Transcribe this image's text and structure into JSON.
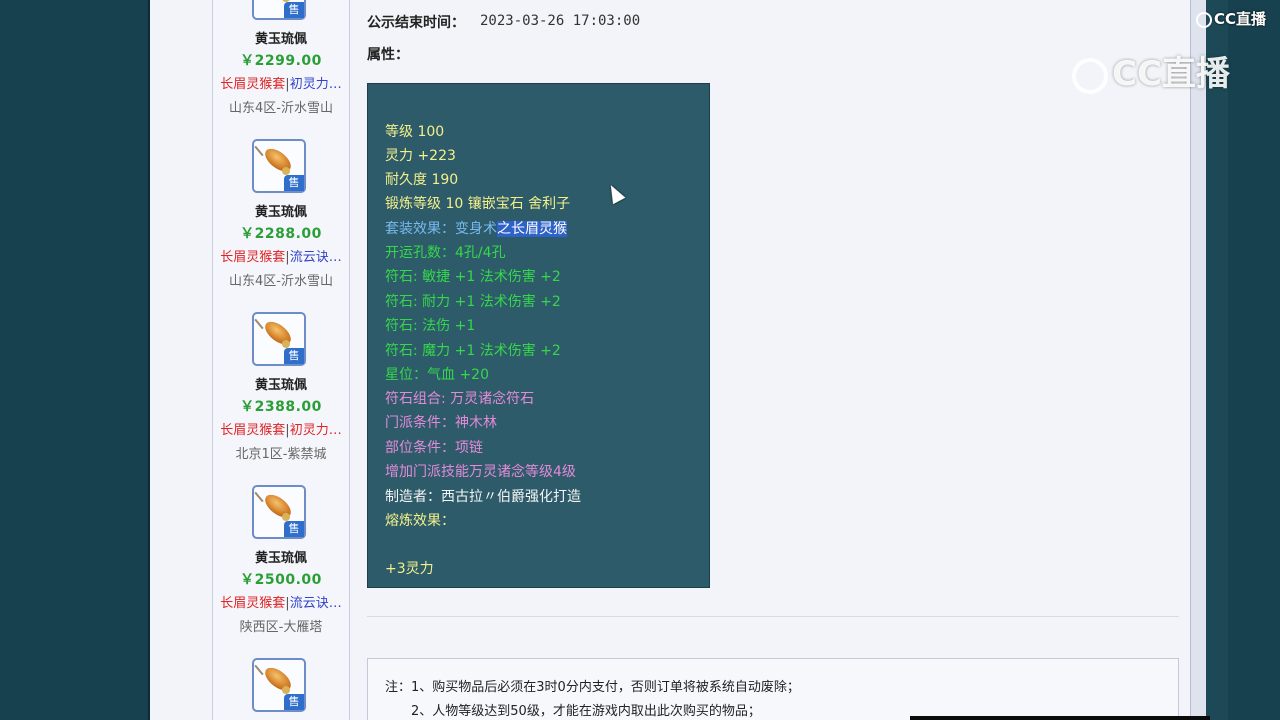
{
  "sidebar": {
    "items": [
      {
        "name": "黄玉琉佩",
        "price": "￥2299.00",
        "tag_a": "长眉灵猴套",
        "tag_sep": "|",
        "tag_b": "初灵力…",
        "server": "山东4区-沂水雪山",
        "badge": "售"
      },
      {
        "name": "黄玉琉佩",
        "price": "￥2288.00",
        "tag_a": "长眉灵猴套",
        "tag_sep": "|",
        "tag_b": "流云诀…",
        "server": "山东4区-沂水雪山",
        "badge": "售"
      },
      {
        "name": "黄玉琉佩",
        "price": "￥2388.00",
        "tag_a": "长眉灵猴套",
        "tag_sep": "|",
        "tag_b": "初灵力…",
        "server": "北京1区-紫禁城",
        "badge": "售"
      },
      {
        "name": "黄玉琉佩",
        "price": "￥2500.00",
        "tag_a": "长眉灵猴套",
        "tag_sep": "|",
        "tag_b": "流云诀…",
        "server": "陕西区-大雁塔",
        "badge": "售"
      },
      {
        "badge": "售"
      }
    ]
  },
  "detail": {
    "end_time_label": "公示结束时间：",
    "end_time_value": "2023-03-26 17:03:00",
    "attr_label": "属性："
  },
  "attributes": {
    "level": "等级 100",
    "spirit": "灵力 +223",
    "durability": "耐久度 190",
    "forge": "锻炼等级 10 镶嵌宝石 舍利子",
    "set_prefix": "套装效果：变身术",
    "set_highlight": "之长眉灵猴",
    "slots": "开运孔数：4孔/4孔",
    "rune1": "符石: 敏捷 +1 法术伤害 +2",
    "rune2": "符石: 耐力 +1 法术伤害 +2",
    "rune3": "符石: 法伤 +1",
    "rune4": "符石: 魔力 +1 法术伤害 +2",
    "star": "星位：气血 +20",
    "rune_combo": "符石组合: 万灵诸念符石",
    "school_req": "门派条件：神木林",
    "slot_req": "部位条件：项链",
    "skill_bonus": "增加门派技能万灵诸念等级4级",
    "maker": "制造者：西古拉〃伯爵强化打造",
    "smelt_label": "熔炼效果：",
    "smelt_value": "+3灵力"
  },
  "notes": {
    "line1": "注：1、购买物品后必须在3时0分内支付，否则订单将被系统自动废除；",
    "line2": "2、人物等级达到50级，才能在游戏内取出此次购买的物品；"
  },
  "watermark": {
    "small": "CC直播",
    "large": "CC直播"
  },
  "icons": {
    "item_icon": "jade-pendant-icon",
    "cursor": "mouse-pointer-icon"
  },
  "colors": {
    "price_green": "#2a9f35",
    "tag_red": "#e02424",
    "tag_blue": "#3244c8",
    "attr_bg": "#2d5b6a",
    "highlight": "#2f62c9"
  }
}
